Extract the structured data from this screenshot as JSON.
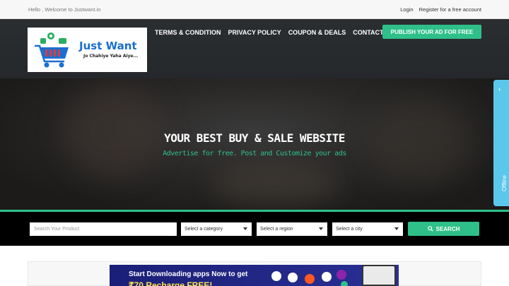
{
  "topbar": {
    "welcome": "Hello , Welcome to Justwant.in",
    "login": "Login",
    "register": "Register for a free account"
  },
  "logo": {
    "brand": "Just Want",
    "tagline": "Jo Chahiye Yaha Aiye..."
  },
  "nav": {
    "items": [
      "TERMS & CONDITION",
      "PRIVACY POLICY",
      "COUPON & DEALS",
      "CONTACT"
    ],
    "publish_label": "PUBLISH YOUR AD FOR FREE"
  },
  "hero": {
    "title": "YOUR BEST BUY & SALE WEBSITE",
    "subtitle": "Advertise for free. Post and Customize your ads"
  },
  "search": {
    "placeholder": "Search Your Product",
    "category": "Select a category",
    "region": "Select a region",
    "city": "Select a city",
    "button_label": "SEARCH"
  },
  "offline_tab": {
    "label": "Offline"
  },
  "banner": {
    "line1": "Start Downloading apps Now to get",
    "line2": "₹70 Recharge FREE!"
  },
  "colors": {
    "accent": "#2fc08a",
    "header_bg": "#2b2e31",
    "offline_tab": "#5bc7eb",
    "brand_blue": "#1a6fd1"
  }
}
